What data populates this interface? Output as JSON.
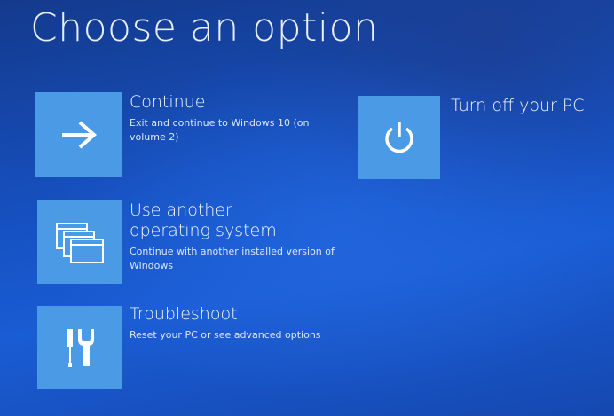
{
  "page": {
    "title": "Choose an option"
  },
  "options": {
    "continue": {
      "label": "Continue",
      "description": "Exit and continue to Windows 10 (on volume 2)",
      "icon": "arrow-right-icon"
    },
    "use_another_os": {
      "label": "Use another operating system",
      "description": "Continue with another installed version of Windows",
      "icon": "windows-stack-icon"
    },
    "troubleshoot": {
      "label": "Troubleshoot",
      "description": "Reset your PC or see advanced options",
      "icon": "tools-icon"
    },
    "turn_off": {
      "label": "Turn off your PC",
      "icon": "power-icon"
    }
  },
  "colors": {
    "tile": "#4a9ae6",
    "background": "#1652c4",
    "text": "#ffffff"
  }
}
